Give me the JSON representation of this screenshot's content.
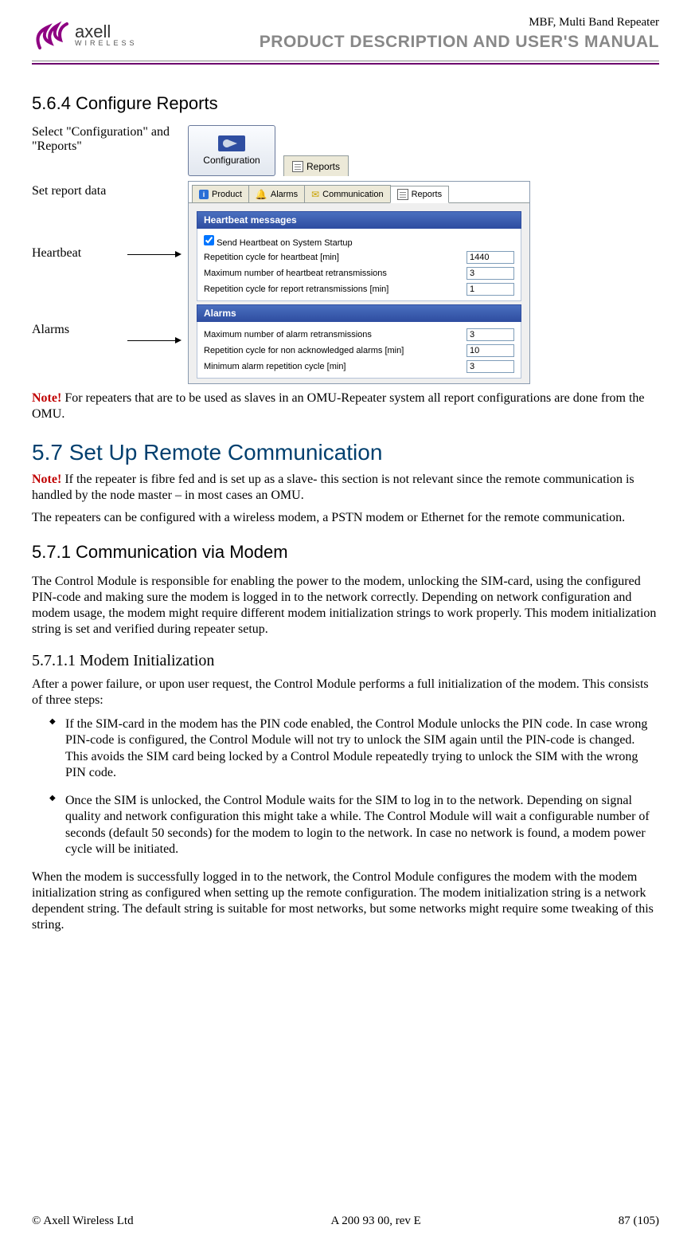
{
  "header": {
    "logo_name": "axell",
    "logo_sub": "WIRELESS",
    "doc_title1": "MBF, Multi Band Repeater",
    "doc_title2": "PRODUCT DESCRIPTION AND USER'S MANUAL"
  },
  "section_564": {
    "heading": "5.6.4    Configure Reports",
    "step1_label": "Select \"Configuration\" and \"Reports\"",
    "config_btn_label": "Configuration",
    "reports_tab_label": "Reports",
    "step2_label": "Set report data",
    "heartbeat_label": "Heartbeat",
    "alarms_label": "Alarms",
    "tabs": {
      "product": "Product",
      "alarms": "Alarms",
      "communication": "Communication",
      "reports": "Reports"
    },
    "group_heartbeat": {
      "title": "Heartbeat messages",
      "cb_label": "Send Heartbeat on System Startup",
      "rows": [
        {
          "label": "Repetition cycle for heartbeat [min]",
          "value": "1440"
        },
        {
          "label": "Maximum number of heartbeat retransmissions",
          "value": "3"
        },
        {
          "label": "Repetition cycle for report retransmissions [min]",
          "value": "1"
        }
      ]
    },
    "group_alarms": {
      "title": "Alarms",
      "rows": [
        {
          "label": "Maximum number of alarm retransmissions",
          "value": "3"
        },
        {
          "label": "Repetition cycle for non acknowledged alarms [min]",
          "value": "10"
        },
        {
          "label": "Minimum alarm repetition cycle [min]",
          "value": "3"
        }
      ]
    },
    "note_prefix": "Note!",
    "note_text": " For repeaters that are to be used as slaves in an OMU-Repeater system all report configurations are done from the OMU."
  },
  "section_57": {
    "heading": "5.7    Set Up Remote Communication",
    "note_prefix": "Note!",
    "note_text": " If the repeater is fibre fed and is set up as a slave- this section is not relevant since the remote communication is handled by the node master – in most cases an OMU.",
    "p1": "The repeaters can be configured with a wireless modem, a PSTN modem or Ethernet for the remote communication."
  },
  "section_571": {
    "heading": "5.7.1    Communication via Modem",
    "p1": "The Control Module is responsible for enabling the power to the modem, unlocking the SIM-card, using the configured PIN-code and making sure the modem is logged in to the network correctly. Depending on network configuration and modem usage, the modem might require different modem initialization strings to work properly. This modem initialization string is set and verified during repeater setup."
  },
  "section_5711": {
    "heading": "5.7.1.1    Modem Initialization",
    "p1": "After a power failure, or upon user request, the Control Module performs a full initialization of the modem. This consists of three steps:",
    "bullets": [
      "If the SIM-card in the modem has the PIN code enabled, the Control Module unlocks the PIN code. In case wrong PIN-code is configured, the Control Module will not try to unlock the SIM again until the PIN-code is changed. This avoids the SIM card being locked by a Control Module repeatedly trying to unlock the SIM with the wrong PIN code.",
      "Once the SIM is unlocked, the Control Module waits for the SIM to log in to the network. Depending on signal quality and network configuration this might take a while. The Control Module will wait a configurable number of seconds (default 50 seconds) for the modem to login to the network. In case no network is found, a modem power cycle will be initiated."
    ],
    "p2": "When the modem is successfully logged in to the network, the Control Module configures the modem with the modem initialization string as configured when setting up the remote configuration. The modem initialization string is a network dependent string. The default string is suitable for most networks, but some networks might require some tweaking of this string."
  },
  "footer": {
    "left": "© Axell Wireless Ltd",
    "center": "A 200 93 00, rev E",
    "right": "87 (105)"
  }
}
